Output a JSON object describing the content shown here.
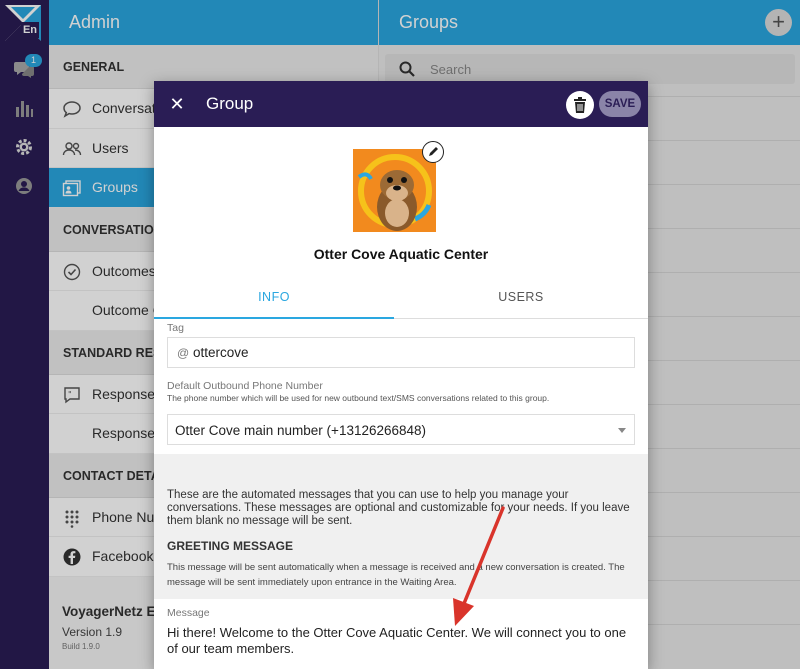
{
  "rail": {
    "logo_text": "En",
    "conversations_badge": "1",
    "colors": {
      "rail_bg": "#2a1d55",
      "accent": "#2aa7e0"
    }
  },
  "admin": {
    "title": "Admin",
    "sections": [
      {
        "heading": "GENERAL",
        "items": [
          {
            "label": "Conversations",
            "icon": "chat-bubble-icon"
          },
          {
            "label": "Users",
            "icon": "users-icon"
          },
          {
            "label": "Groups",
            "icon": "groups-icon",
            "active": true
          }
        ]
      },
      {
        "heading": "CONVERSATIONS",
        "items": [
          {
            "label": "Outcomes",
            "icon": "check-circle-icon"
          },
          {
            "label": "Outcome Categories",
            "icon": ""
          }
        ]
      },
      {
        "heading": "STANDARD RESPONSES",
        "items": [
          {
            "label": "Responses",
            "icon": "quote-icon"
          },
          {
            "label": "Response Categories",
            "icon": ""
          }
        ]
      },
      {
        "heading": "CONTACT DETAILS",
        "items": [
          {
            "label": "Phone Numbers",
            "icon": "dialpad-icon"
          },
          {
            "label": "Facebook",
            "icon": "facebook-icon"
          }
        ]
      }
    ],
    "footer": {
      "app_name": "VoyagerNetz Engage",
      "version": "Version 1.9",
      "build": "Build 1.9.0"
    }
  },
  "groups": {
    "title": "Groups",
    "search_placeholder": "Search"
  },
  "modal": {
    "title": "Group",
    "save_label": "SAVE",
    "group_name": "Otter Cove Aquatic Center",
    "tabs": [
      "INFO",
      "USERS"
    ],
    "active_tab": "INFO",
    "tag": {
      "label": "Tag",
      "prefix": "@",
      "value": "ottercove"
    },
    "phone": {
      "label": "Default Outbound Phone Number",
      "help": "The phone number which will be used for new outbound text/SMS conversations related to this group.",
      "value": "Otter Cove main number (+13126266848)"
    },
    "intro": "These are the automated messages that you can use to help you manage your conversations. These messages are optional and customizable for your needs. If you leave them blank no message will be sent.",
    "greeting": {
      "heading": "GREETING MESSAGE",
      "description": "This message will be sent automatically when a message is received and a new conversation is created. The message will be sent immediately upon entrance in the Waiting Area.",
      "message_label": "Message",
      "message": "Hi there!  Welcome to the Otter Cove Aquatic Center.  We will connect you to one of our team members."
    }
  }
}
